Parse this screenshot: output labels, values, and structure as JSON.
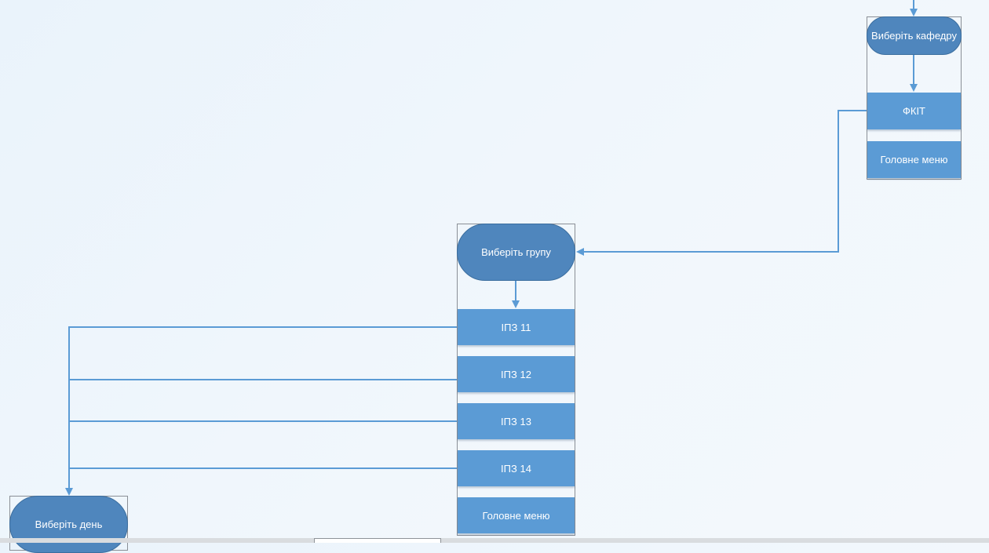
{
  "colors": {
    "terminal_fill": "#4f86bd",
    "option_fill": "#5b9bd5",
    "connector": "#5b9bd5",
    "frame_border": "#8a8f96",
    "text": "#ffffff"
  },
  "department": {
    "prompt": "Виберіть кафедру",
    "options": [
      "ФКІТ",
      "Головне меню"
    ]
  },
  "group": {
    "prompt": "Виберіть групу",
    "options": [
      "ІПЗ 11",
      "ІПЗ 12",
      "ІПЗ 13",
      "ІПЗ 14",
      "Головне меню"
    ]
  },
  "day": {
    "prompt": "Виберіть день"
  }
}
